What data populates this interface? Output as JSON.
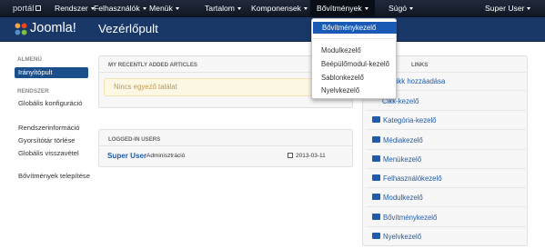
{
  "topbar": {
    "portal": "portál",
    "menus": [
      {
        "label": "Rendszer"
      },
      {
        "label": "Felhasználók"
      },
      {
        "label": "Menük"
      },
      {
        "label": "Tartalom"
      },
      {
        "label": "Komponensek"
      },
      {
        "label": "Bővítmények"
      },
      {
        "label": "Súgó"
      }
    ],
    "user": "Super User"
  },
  "header": {
    "logo_text": "Joomla!",
    "title": "Vezérlőpult"
  },
  "sidebar": {
    "section_main": "ALMENÜ",
    "active_item": "Irányítópult",
    "section_system": "RENDSZER",
    "links": [
      {
        "label": "Globális konfiguráció"
      },
      {
        "label": "Rendszerinformáció"
      },
      {
        "label": "Gyorsítótár törlése"
      },
      {
        "label": "Globális visszavétel"
      },
      {
        "label": "Bővítmények telepítése"
      }
    ]
  },
  "recent_articles": {
    "heading": "MY RECENTLY ADDED ARTICLES",
    "empty_message": "Nincs egyező találat"
  },
  "logged_in": {
    "heading": "LOGGED-IN USERS",
    "user_name": "Super User",
    "user_role": "Adminisztráció",
    "date": "2013-03-11"
  },
  "quicklinks": {
    "heading": "LINKS",
    "items": [
      {
        "label": "Cikk hozzáadása",
        "icon": "add-article-icon"
      },
      {
        "label": "Cikk-kezelő",
        "icon": "article-manager-icon"
      },
      {
        "label": "Kategória-kezelő",
        "icon": "folder-icon"
      },
      {
        "label": "Médiakezelő",
        "icon": "media-icon"
      },
      {
        "label": "Menükezelő",
        "icon": "list-icon"
      },
      {
        "label": "Felhasználókezelő",
        "icon": "users-icon"
      },
      {
        "label": "Modulkezelő",
        "icon": "cube-icon"
      },
      {
        "label": "Bővítménykezelő",
        "icon": "puzzle-icon"
      },
      {
        "label": "Nyelvkezelő",
        "icon": "comment-icon"
      }
    ]
  },
  "dropdown": {
    "items": [
      {
        "label": "Bővítménykezelő"
      },
      {
        "label": "Modulkezelő"
      },
      {
        "label": "Beépülőmodul-kezelő"
      },
      {
        "label": "Sablonkezelő"
      },
      {
        "label": "Nyelvkezelő"
      }
    ]
  },
  "colors": {
    "navbar": "#1b2535",
    "header": "#1a3867",
    "link": "#1f5ba8",
    "active": "#1a5ab7"
  }
}
